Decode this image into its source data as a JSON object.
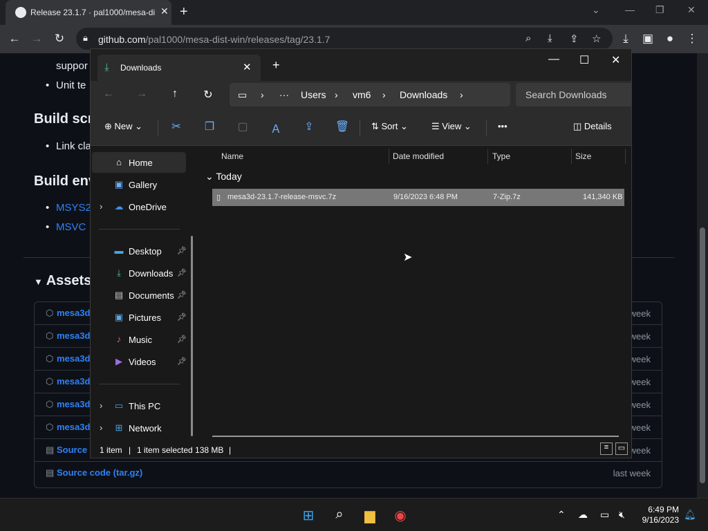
{
  "browser": {
    "tab_title": "Release 23.1.7 · pal1000/mesa-di",
    "url_domain": "github.com",
    "url_path": "/pal1000/mesa-dist-win/releases/tag/23.1.7"
  },
  "github": {
    "support_text": "suppor",
    "unit_text": "Unit te",
    "build_scripts_heading": "Build scri",
    "link_text": "Link cla",
    "build_env_heading": "Build env",
    "msys_link": "MSYS2",
    "msvc_link": "MSVC",
    "assets_heading": "Assets",
    "assets": [
      {
        "name": "mesa3d",
        "when": "week"
      },
      {
        "name": "mesa3d",
        "when": "week"
      },
      {
        "name": "mesa3d",
        "when": "week"
      },
      {
        "name": "mesa3d",
        "when": "week"
      },
      {
        "name": "mesa3d",
        "when": "week"
      },
      {
        "name": "mesa3d",
        "when": "week"
      },
      {
        "name": "Source",
        "when": "week"
      },
      {
        "name": "Source code (tar.gz)",
        "when": "last week"
      }
    ]
  },
  "explorer": {
    "tab_label": "Downloads",
    "breadcrumb": [
      "Users",
      "vm6",
      "Downloads"
    ],
    "search_placeholder": "Search Downloads",
    "commands": {
      "new": "New",
      "sort": "Sort",
      "view": "View",
      "details": "Details"
    },
    "nav": {
      "home": "Home",
      "gallery": "Gallery",
      "onedrive": "OneDrive",
      "desktop": "Desktop",
      "downloads": "Downloads",
      "documents": "Documents",
      "pictures": "Pictures",
      "music": "Music",
      "videos": "Videos",
      "thispc": "This PC",
      "network": "Network"
    },
    "columns": {
      "name": "Name",
      "date": "Date modified",
      "type": "Type",
      "size": "Size"
    },
    "group": "Today",
    "file": {
      "name": "mesa3d-23.1.7-release-msvc.7z",
      "date": "9/16/2023 6:48 PM",
      "type": "7-Zip.7z",
      "size": "141,340 KB"
    },
    "status": {
      "items": "1 item",
      "selected": "1 item selected  138 MB"
    }
  },
  "taskbar": {
    "time": "6:49 PM",
    "date": "9/16/2023"
  }
}
